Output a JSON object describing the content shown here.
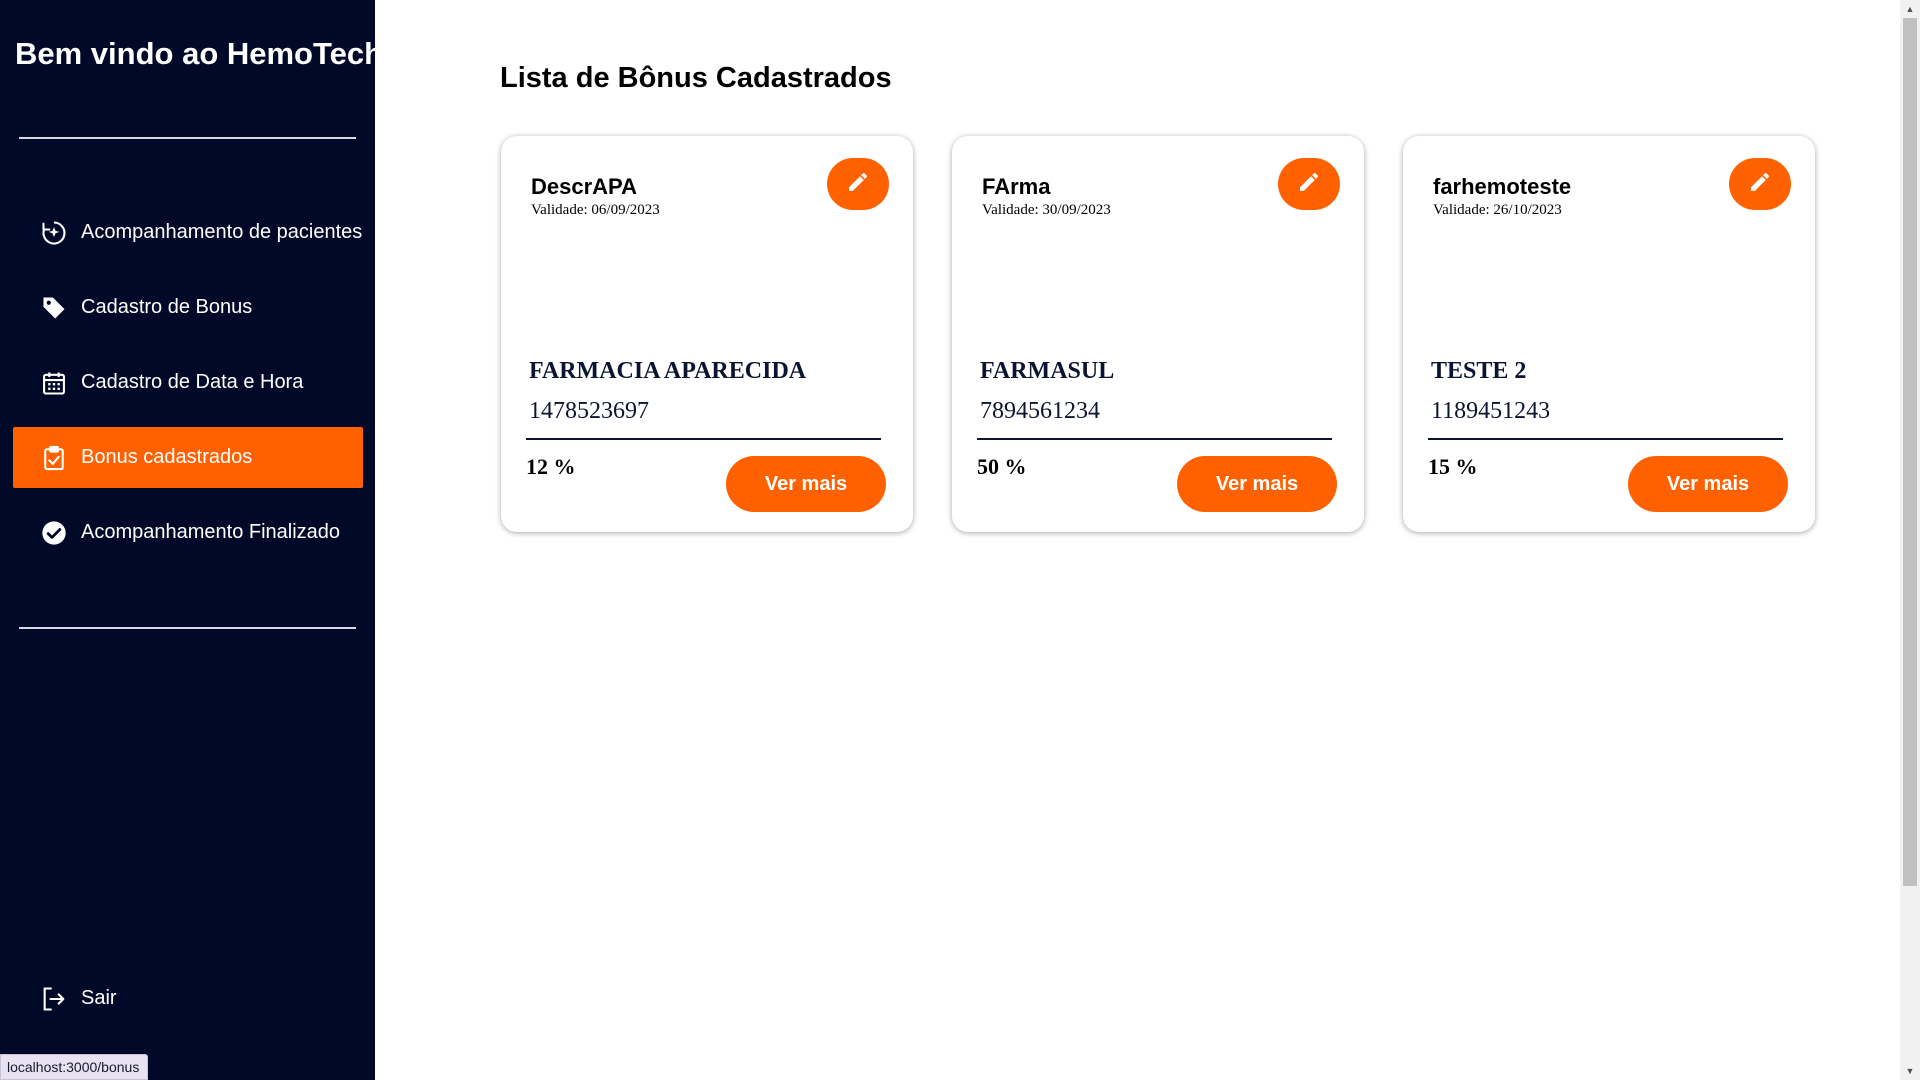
{
  "sidebar": {
    "title": "Bem vindo ao HemoTech",
    "items": [
      {
        "label": "Acompanhamento de pacientes",
        "icon": "patient-tracking-icon",
        "active": false
      },
      {
        "label": "Cadastro de Bonus",
        "icon": "tag-icon",
        "active": false
      },
      {
        "label": "Cadastro de Data e Hora",
        "icon": "calendar-icon",
        "active": false
      },
      {
        "label": "Bonus cadastrados",
        "icon": "clipboard-check-icon",
        "active": true
      },
      {
        "label": "Acompanhamento Finalizado",
        "icon": "check-circle-icon",
        "active": false
      }
    ],
    "logout_label": "Sair"
  },
  "main": {
    "title": "Lista de Bônus Cadastrados",
    "cards": [
      {
        "name": "DescrAPA",
        "validity": "Validade: 06/09/2023",
        "pharmacy": "FARMACIA APARECIDA",
        "phone": "1478523697",
        "discount": "12 %",
        "button": "Ver mais"
      },
      {
        "name": "FArma",
        "validity": "Validade: 30/09/2023",
        "pharmacy": "FARMASUL",
        "phone": "7894561234",
        "discount": "50 %",
        "button": "Ver mais"
      },
      {
        "name": "farhemoteste",
        "validity": "Validade: 26/10/2023",
        "pharmacy": "TESTE 2",
        "phone": "1189451243",
        "discount": "15 %",
        "button": "Ver mais"
      }
    ]
  },
  "status_bar": {
    "url": "localhost:3000/bonus"
  },
  "colors": {
    "accent": "#ff6100",
    "sidebar_bg": "#000a28"
  }
}
